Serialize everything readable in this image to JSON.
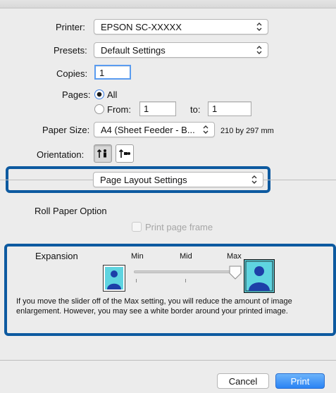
{
  "printer": {
    "label": "Printer:",
    "value": "EPSON SC-XXXXX"
  },
  "presets": {
    "label": "Presets:",
    "value": "Default Settings"
  },
  "copies": {
    "label": "Copies:",
    "value": "1"
  },
  "pages": {
    "label": "Pages:",
    "all_label": "All",
    "from_label": "From:",
    "from_value": "1",
    "to_label": "to:",
    "to_value": "1",
    "selected": "All"
  },
  "paper_size": {
    "label": "Paper Size:",
    "value": "A4 (Sheet Feeder - B...",
    "dimensions": "210 by 297 mm"
  },
  "orientation": {
    "label": "Orientation:",
    "selected": "portrait"
  },
  "section_popup": {
    "value": "Page Layout Settings"
  },
  "roll_paper": {
    "title": "Roll Paper Option",
    "print_frame_label": "Print page frame",
    "print_frame_checked": false,
    "print_frame_enabled": false
  },
  "expansion": {
    "title": "Expansion",
    "min_label": "Min",
    "mid_label": "Mid",
    "max_label": "Max",
    "level": "Max",
    "description": "If you move the slider off of the Max setting, you will reduce the amount of image enlargement. However, you may see a white border around your printed image."
  },
  "footer": {
    "cancel_label": "Cancel",
    "print_label": "Print"
  },
  "colors": {
    "accent": "#2a83f4",
    "highlight": "#0d5aa0",
    "figure_bg": "#5fd4e0",
    "figure": "#1d3fa8"
  }
}
